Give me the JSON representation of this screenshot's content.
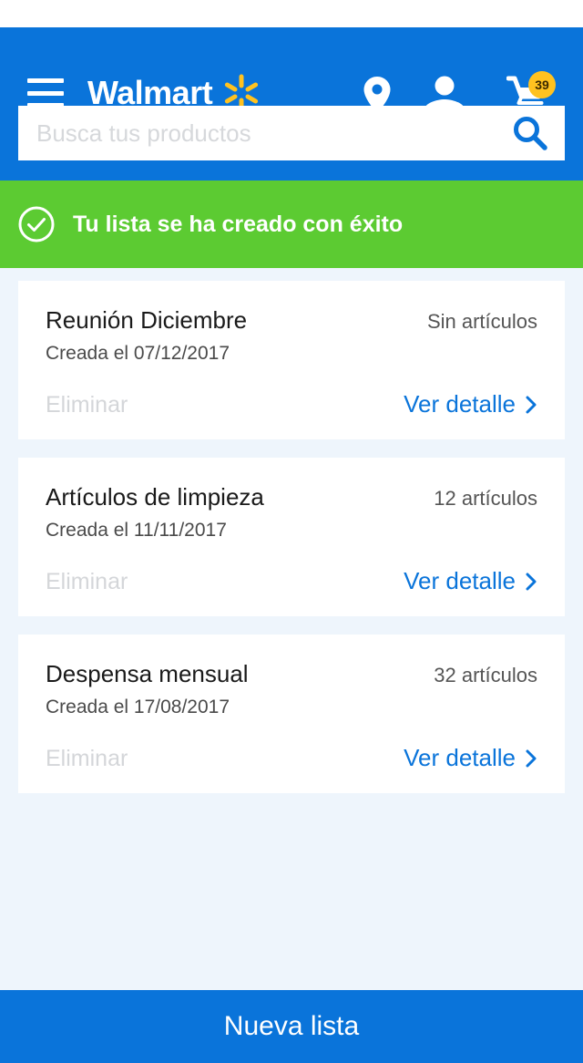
{
  "header": {
    "logo_text": "Walmart",
    "cart_count": "39",
    "brand_color": "#0a74da",
    "spark_color": "#ffc220",
    "icons": [
      "menu-icon",
      "walmart-spark-icon",
      "location-icon",
      "user-icon",
      "cart-icon"
    ]
  },
  "search": {
    "placeholder": "Busca tus productos",
    "value": ""
  },
  "banner": {
    "text": "Tu lista se ha creado con éxito",
    "color": "#5ccb32"
  },
  "lists": [
    {
      "title": "Reunión Diciembre",
      "count": "Sin artículos",
      "date": "Creada el 07/12/2017",
      "delete_label": "Eliminar",
      "detail_label": "Ver detalle"
    },
    {
      "title": "Artículos de limpieza",
      "count": "12 artículos",
      "date": "Creada el 11/11/2017",
      "delete_label": "Eliminar",
      "detail_label": "Ver detalle"
    },
    {
      "title": "Despensa mensual",
      "count": "32 artículos",
      "date": "Creada el 17/08/2017",
      "delete_label": "Eliminar",
      "detail_label": "Ver detalle"
    }
  ],
  "footer": {
    "new_list_label": "Nueva lista"
  }
}
